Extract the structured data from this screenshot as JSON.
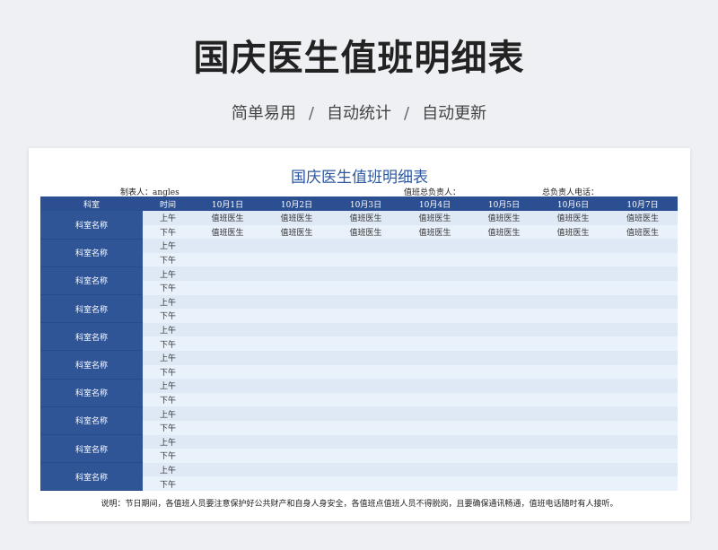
{
  "header": {
    "title": "国庆医生值班明细表",
    "subtitle": [
      "简单易用",
      "自动统计",
      "自动更新"
    ],
    "separator": "/"
  },
  "sheet": {
    "title": "国庆医生值班明细表",
    "maker_label": "制表人：angles",
    "duty_label": "值班总负责人：",
    "phone_label": "总负责人电话："
  },
  "table": {
    "dept_header": "科室",
    "time_header": "时间",
    "dates": [
      "10月1日",
      "10月2日",
      "10月3日",
      "10月4日",
      "10月5日",
      "10月6日",
      "10月7日"
    ],
    "am": "上午",
    "pm": "下午",
    "dept_name": "科室名称",
    "rows": [
      {
        "am": [
          "值班医生",
          "值班医生",
          "值班医生",
          "值班医生",
          "值班医生",
          "值班医生",
          "值班医生"
        ],
        "pm": [
          "值班医生",
          "值班医生",
          "值班医生",
          "值班医生",
          "值班医生",
          "值班医生",
          "值班医生"
        ]
      },
      {
        "am": [
          "",
          "",
          "",
          "",
          "",
          "",
          ""
        ],
        "pm": [
          "",
          "",
          "",
          "",
          "",
          "",
          ""
        ]
      },
      {
        "am": [
          "",
          "",
          "",
          "",
          "",
          "",
          ""
        ],
        "pm": [
          "",
          "",
          "",
          "",
          "",
          "",
          ""
        ]
      },
      {
        "am": [
          "",
          "",
          "",
          "",
          "",
          "",
          ""
        ],
        "pm": [
          "",
          "",
          "",
          "",
          "",
          "",
          ""
        ]
      },
      {
        "am": [
          "",
          "",
          "",
          "",
          "",
          "",
          ""
        ],
        "pm": [
          "",
          "",
          "",
          "",
          "",
          "",
          ""
        ]
      },
      {
        "am": [
          "",
          "",
          "",
          "",
          "",
          "",
          ""
        ],
        "pm": [
          "",
          "",
          "",
          "",
          "",
          "",
          ""
        ]
      },
      {
        "am": [
          "",
          "",
          "",
          "",
          "",
          "",
          ""
        ],
        "pm": [
          "",
          "",
          "",
          "",
          "",
          "",
          ""
        ]
      },
      {
        "am": [
          "",
          "",
          "",
          "",
          "",
          "",
          ""
        ],
        "pm": [
          "",
          "",
          "",
          "",
          "",
          "",
          ""
        ]
      },
      {
        "am": [
          "",
          "",
          "",
          "",
          "",
          "",
          ""
        ],
        "pm": [
          "",
          "",
          "",
          "",
          "",
          "",
          ""
        ]
      },
      {
        "am": [
          "",
          "",
          "",
          "",
          "",
          "",
          ""
        ],
        "pm": [
          "",
          "",
          "",
          "",
          "",
          "",
          ""
        ]
      }
    ]
  },
  "note": "说明：节日期间，各值班人员要注意保护好公共财产和自身人身安全，各值班点值班人员不得脱岗，且要确保通讯畅通，值班电话随时有人接听。",
  "colors": {
    "header_blue": "#2b4f90",
    "dept_blue": "#2f5597",
    "row_light": "#dfe9f5",
    "title_blue": "#2c57a0"
  }
}
